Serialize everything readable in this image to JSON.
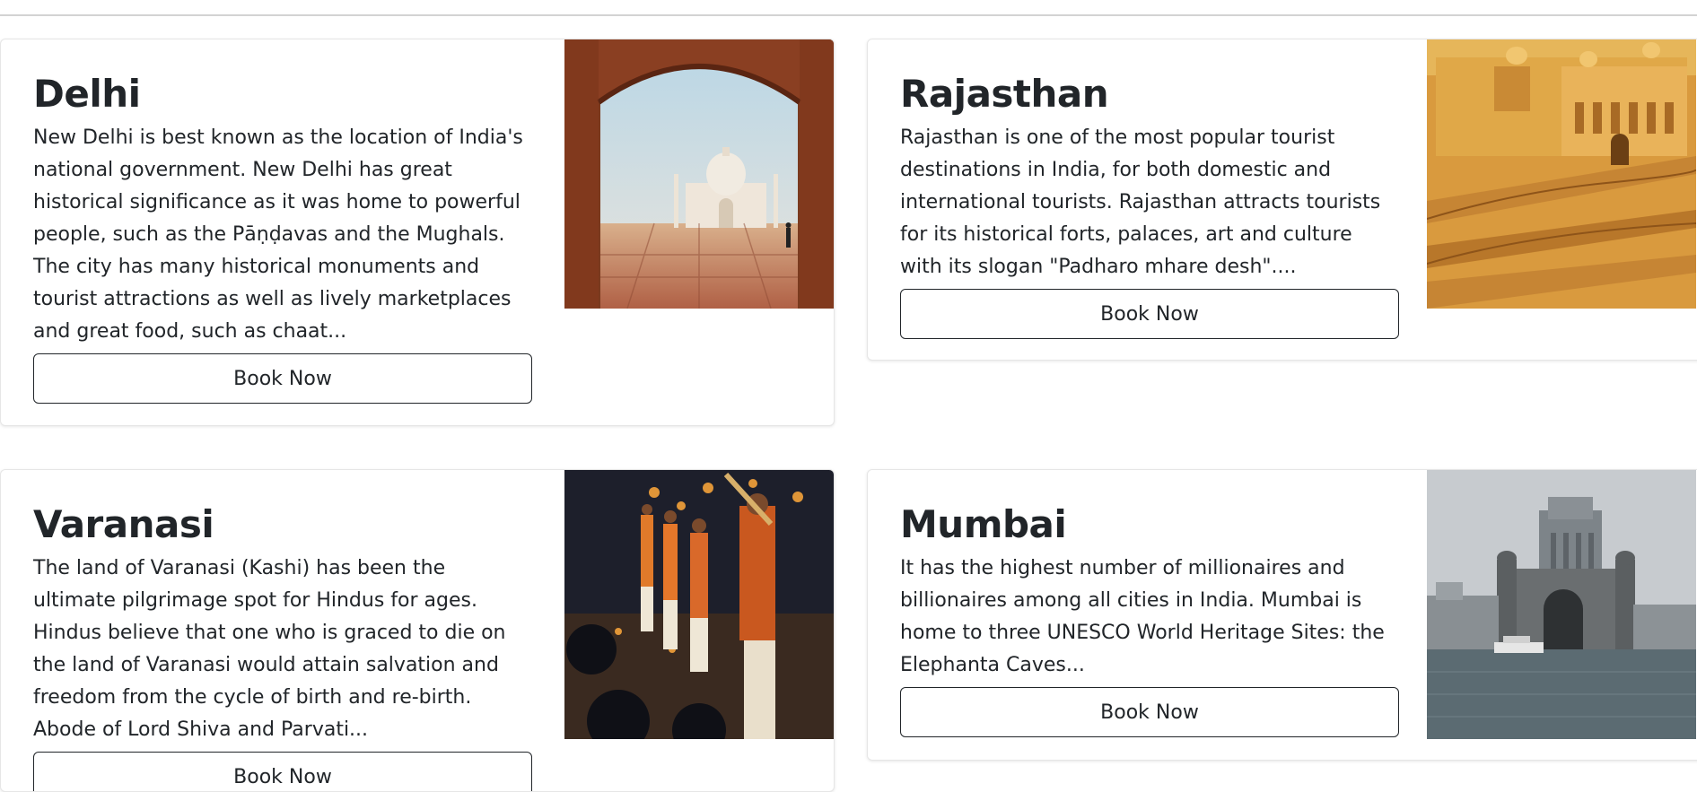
{
  "cards": [
    {
      "title": "Delhi",
      "description": "New Delhi is best known as the location of India's national government. New Delhi has great historical significance as it was home to powerful people, such as the Pāṇḍavas and the Mughals. The city has many historical monuments and tourist attractions as well as lively marketplaces and great food, such as chaat...",
      "button_label": "Book Now",
      "image": "taj-mahal-through-arch"
    },
    {
      "title": "Rajasthan",
      "description": "Rajasthan is one of the most popular tourist destinations in India, for both domestic and international tourists. Rajasthan attracts tourists for its historical forts, palaces, art and culture with its slogan \"Padharo mhare desh\"....",
      "button_label": "Book Now",
      "image": "amber-fort"
    },
    {
      "title": "Varanasi",
      "description": "The land of Varanasi (Kashi) has been the ultimate pilgrimage spot for Hindus for ages. Hindus believe that one who is graced to die on the land of Varanasi would attain salvation and freedom from the cycle of birth and re-birth. Abode of Lord Shiva and Parvati...",
      "button_label": "Book Now",
      "image": "ganga-aarti-ceremony"
    },
    {
      "title": "Mumbai",
      "description": "It has the highest number of millionaires and billionaires among all cities in India. Mumbai is home to three UNESCO World Heritage Sites: the Elephanta Caves...",
      "button_label": "Book Now",
      "image": "gateway-of-india"
    }
  ]
}
